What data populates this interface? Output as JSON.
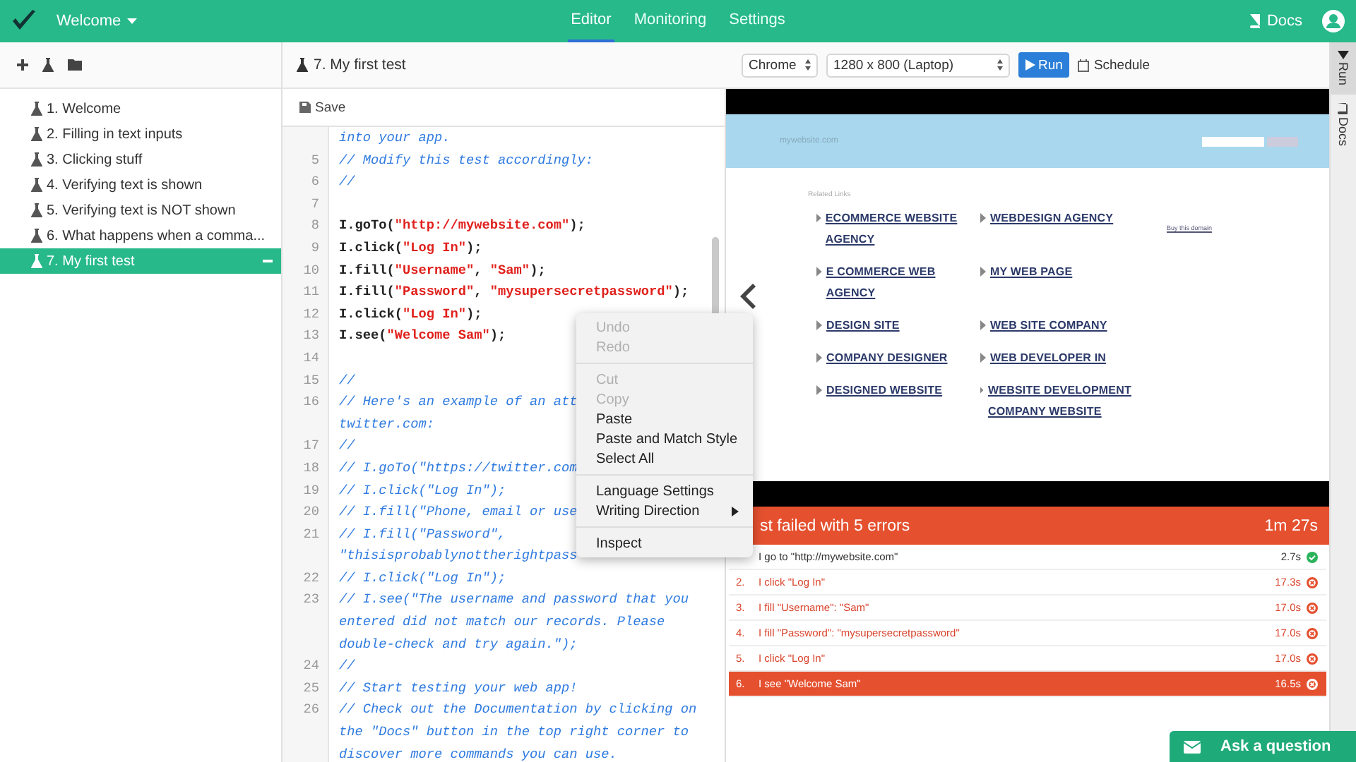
{
  "topbar": {
    "project": "Welcome",
    "tabs": [
      {
        "label": "Editor",
        "selected": true
      },
      {
        "label": "Monitoring",
        "selected": false
      },
      {
        "label": "Settings",
        "selected": false
      }
    ],
    "docs": "Docs"
  },
  "sidebar": {
    "items": [
      {
        "label": "1. Welcome",
        "selected": false
      },
      {
        "label": "2. Filling in text inputs",
        "selected": false
      },
      {
        "label": "3. Clicking stuff",
        "selected": false
      },
      {
        "label": "4. Verifying text is shown",
        "selected": false
      },
      {
        "label": "5. Verifying text is NOT shown",
        "selected": false
      },
      {
        "label": "6. What happens when a comma...",
        "selected": false
      },
      {
        "label": "7. My first test",
        "selected": true
      }
    ]
  },
  "editor": {
    "title": "7. My first test",
    "save": "Save",
    "lines": [
      {
        "tokens": [
          {
            "kind": "comment",
            "text": "into your app."
          }
        ]
      },
      {
        "number": "5",
        "tokens": [
          {
            "kind": "comment",
            "text": "// Modify this test accordingly:"
          }
        ]
      },
      {
        "number": "6",
        "tokens": [
          {
            "kind": "comment",
            "text": "//"
          }
        ]
      },
      {
        "number": "7"
      },
      {
        "number": "8",
        "tokens": [
          {
            "kind": "code",
            "text": "I.goTo("
          },
          {
            "kind": "string",
            "text": "\"http://mywebsite.com\""
          },
          {
            "kind": "code",
            "text": ");"
          }
        ]
      },
      {
        "number": "9",
        "tokens": [
          {
            "kind": "code",
            "text": "I.click("
          },
          {
            "kind": "string",
            "text": "\"Log In\""
          },
          {
            "kind": "code",
            "text": ");"
          }
        ]
      },
      {
        "number": "10",
        "tokens": [
          {
            "kind": "code",
            "text": "I.fill("
          },
          {
            "kind": "string",
            "text": "\"Username\""
          },
          {
            "kind": "code",
            "text": ", "
          },
          {
            "kind": "string",
            "text": "\"Sam\""
          },
          {
            "kind": "code",
            "text": ");"
          }
        ]
      },
      {
        "number": "11",
        "tokens": [
          {
            "kind": "code",
            "text": "I.fill("
          },
          {
            "kind": "string",
            "text": "\"Password\""
          },
          {
            "kind": "code",
            "text": ", "
          },
          {
            "kind": "string",
            "text": "\"mysupersecretpassword\""
          },
          {
            "kind": "code",
            "text": ");"
          }
        ]
      },
      {
        "number": "12",
        "tokens": [
          {
            "kind": "code",
            "text": "I.click("
          },
          {
            "kind": "string",
            "text": "\"Log In\""
          },
          {
            "kind": "code",
            "text": ");"
          }
        ]
      },
      {
        "number": "13",
        "tokens": [
          {
            "kind": "code",
            "text": "I.see("
          },
          {
            "kind": "string",
            "text": "\"Welcome Sam\""
          },
          {
            "kind": "code",
            "text": ");"
          }
        ]
      },
      {
        "number": "14"
      },
      {
        "number": "15",
        "tokens": [
          {
            "kind": "comment",
            "text": "//"
          }
        ]
      },
      {
        "number": "16",
        "tokens": [
          {
            "kind": "comment",
            "text": "// Here's an example of an att"
          }
        ]
      },
      {
        "tokens": [
          {
            "kind": "comment",
            "text": "twitter.com:"
          }
        ]
      },
      {
        "number": "17",
        "tokens": [
          {
            "kind": "comment",
            "text": "//"
          }
        ]
      },
      {
        "number": "18",
        "tokens": [
          {
            "kind": "comment",
            "text": "// I.goTo(\"https://twitter.com"
          }
        ]
      },
      {
        "number": "19",
        "tokens": [
          {
            "kind": "comment",
            "text": "// I.click(\"Log In\");"
          }
        ]
      },
      {
        "number": "20",
        "tokens": [
          {
            "kind": "comment",
            "text": "// I.fill(\"Phone, email or use"
          }
        ]
      },
      {
        "number": "21",
        "tokens": [
          {
            "kind": "comment",
            "text": "// I.fill(\"Password\","
          }
        ]
      },
      {
        "tokens": [
          {
            "kind": "comment",
            "text": "\"thisisprobablynottherightpass"
          }
        ]
      },
      {
        "number": "22",
        "tokens": [
          {
            "kind": "comment",
            "text": "// I.click(\"Log In\");"
          }
        ]
      },
      {
        "number": "23",
        "tokens": [
          {
            "kind": "comment",
            "text": "// I.see(\"The username and password that you"
          }
        ]
      },
      {
        "tokens": [
          {
            "kind": "comment",
            "text": "entered did not match our records. Please"
          }
        ]
      },
      {
        "tokens": [
          {
            "kind": "comment",
            "text": "double-check and try again.\");"
          }
        ]
      },
      {
        "number": "24",
        "tokens": [
          {
            "kind": "comment",
            "text": "//"
          }
        ]
      },
      {
        "number": "25",
        "tokens": [
          {
            "kind": "comment",
            "text": "// Start testing your web app!"
          }
        ]
      },
      {
        "number": "26",
        "tokens": [
          {
            "kind": "comment",
            "text": "// Check out the Documentation by clicking on"
          }
        ]
      },
      {
        "tokens": [
          {
            "kind": "comment",
            "text": "the \"Docs\" button in the top right corner to"
          }
        ]
      },
      {
        "tokens": [
          {
            "kind": "comment",
            "text": "discover more commands you can use."
          }
        ]
      }
    ]
  },
  "runbar": {
    "browser": "Chrome",
    "resolution": "1280 x 800 (Laptop)",
    "run": "Run",
    "schedule": "Schedule"
  },
  "preview": {
    "site_name": "mywebsite.com",
    "related": "Related Links",
    "buy": "Buy this domain",
    "links": [
      "ECOMMERCE WEBSITE AGENCY",
      "WEBDESIGN AGENCY",
      "E COMMERCE WEB AGENCY",
      "MY WEB PAGE",
      "DESIGN SITE",
      "WEB SITE COMPANY",
      "COMPANY DESIGNER",
      "WEB DEVELOPER IN",
      "DESIGNED WEBSITE",
      "WEBSITE DEVELOPMENT COMPANY WEBSITE"
    ]
  },
  "results": {
    "title": "st failed with 5 errors",
    "duration": "1m 27s",
    "steps": [
      {
        "text": "I go to \"http://mywebsite.com\"",
        "time": "2.7s",
        "passed": true,
        "selected": false
      },
      {
        "number": "2.",
        "text": "I click \"Log In\"",
        "time": "17.3s",
        "passed": false,
        "selected": false
      },
      {
        "number": "3.",
        "text": "I fill \"Username\": \"Sam\"",
        "time": "17.0s",
        "passed": false,
        "selected": false
      },
      {
        "number": "4.",
        "text": "I fill \"Password\": \"mysupersecretpassword\"",
        "time": "17.0s",
        "passed": false,
        "selected": false
      },
      {
        "number": "5.",
        "text": "I click \"Log In\"",
        "time": "17.0s",
        "passed": false,
        "selected": false
      },
      {
        "number": "6.",
        "text": "I see \"Welcome Sam\"",
        "time": "16.5s",
        "passed": false,
        "selected": true
      }
    ]
  },
  "side_tabs": [
    {
      "label": "Run",
      "selected": true,
      "kind": "run"
    },
    {
      "label": "Docs",
      "selected": false,
      "kind": "docs"
    }
  ],
  "context_menu": {
    "groups": [
      [
        {
          "label": "Undo",
          "disabled": true
        },
        {
          "label": "Redo",
          "disabled": true
        }
      ],
      [
        {
          "label": "Cut",
          "disabled": true
        },
        {
          "label": "Copy",
          "disabled": true
        },
        {
          "label": "Paste",
          "disabled": false
        },
        {
          "label": "Paste and Match Style",
          "disabled": false
        },
        {
          "label": "Select All",
          "disabled": false
        }
      ],
      [
        {
          "label": "Language Settings",
          "disabled": false
        },
        {
          "label": "Writing Direction",
          "disabled": false,
          "submenu": true
        }
      ],
      [
        {
          "label": "Inspect",
          "disabled": false
        }
      ]
    ]
  },
  "help_button": "Ask a question"
}
